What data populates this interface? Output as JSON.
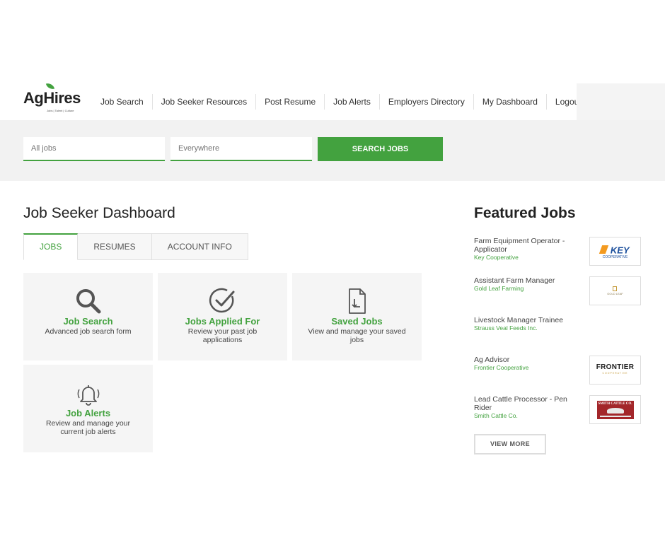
{
  "brand": {
    "name": "AgHires",
    "tagline": "Jobs | Talent | Culture"
  },
  "nav": [
    "Job Search",
    "Job Seeker Resources",
    "Post Resume",
    "Job Alerts",
    "Employers Directory",
    "My Dashboard",
    "Logout"
  ],
  "search": {
    "what_placeholder": "All jobs",
    "where_placeholder": "Everywhere",
    "button_label": "SEARCH JOBS"
  },
  "dashboard": {
    "title": "Job Seeker Dashboard",
    "tabs": [
      "JOBS",
      "RESUMES",
      "ACCOUNT INFO"
    ],
    "active_tab": "JOBS",
    "cards": [
      {
        "icon": "magnifier-icon",
        "title": "Job Search",
        "desc": "Advanced job search form"
      },
      {
        "icon": "check-circle-icon",
        "title": "Jobs Applied For",
        "desc": "Review your past job applications"
      },
      {
        "icon": "document-download-icon",
        "title": "Saved Jobs",
        "desc": "View and manage your saved jobs"
      },
      {
        "icon": "bell-icon",
        "title": "Job Alerts",
        "desc": "Review and manage your current job alerts"
      }
    ]
  },
  "featured": {
    "title": "Featured Jobs",
    "jobs": [
      {
        "title": "Farm Equipment Operator - Applicator",
        "company": "Key Cooperative",
        "logo_text": "KEY",
        "logo_sub": "COOPERATIVE"
      },
      {
        "title": "Assistant Farm Manager",
        "company": "Gold Leaf Farming",
        "logo_text": "GOLD LEAF",
        "logo_sub": ""
      },
      {
        "title": "Livestock Manager Trainee",
        "company": "Strauss Veal Feeds Inc.",
        "logo_text": "",
        "logo_sub": ""
      },
      {
        "title": "Ag Advisor",
        "company": "Frontier Cooperative",
        "logo_text": "FRONTIER",
        "logo_sub": "COOPERATIVE"
      },
      {
        "title": "Lead Cattle Processor - Pen Rider",
        "company": "Smith Cattle Co.",
        "logo_text": "SMITH CATTLE CO.",
        "logo_sub": ""
      }
    ],
    "view_more": "VIEW MORE"
  },
  "colors": {
    "accent": "#43a23f",
    "band": "#f2f2f2",
    "card": "#f5f5f5"
  }
}
